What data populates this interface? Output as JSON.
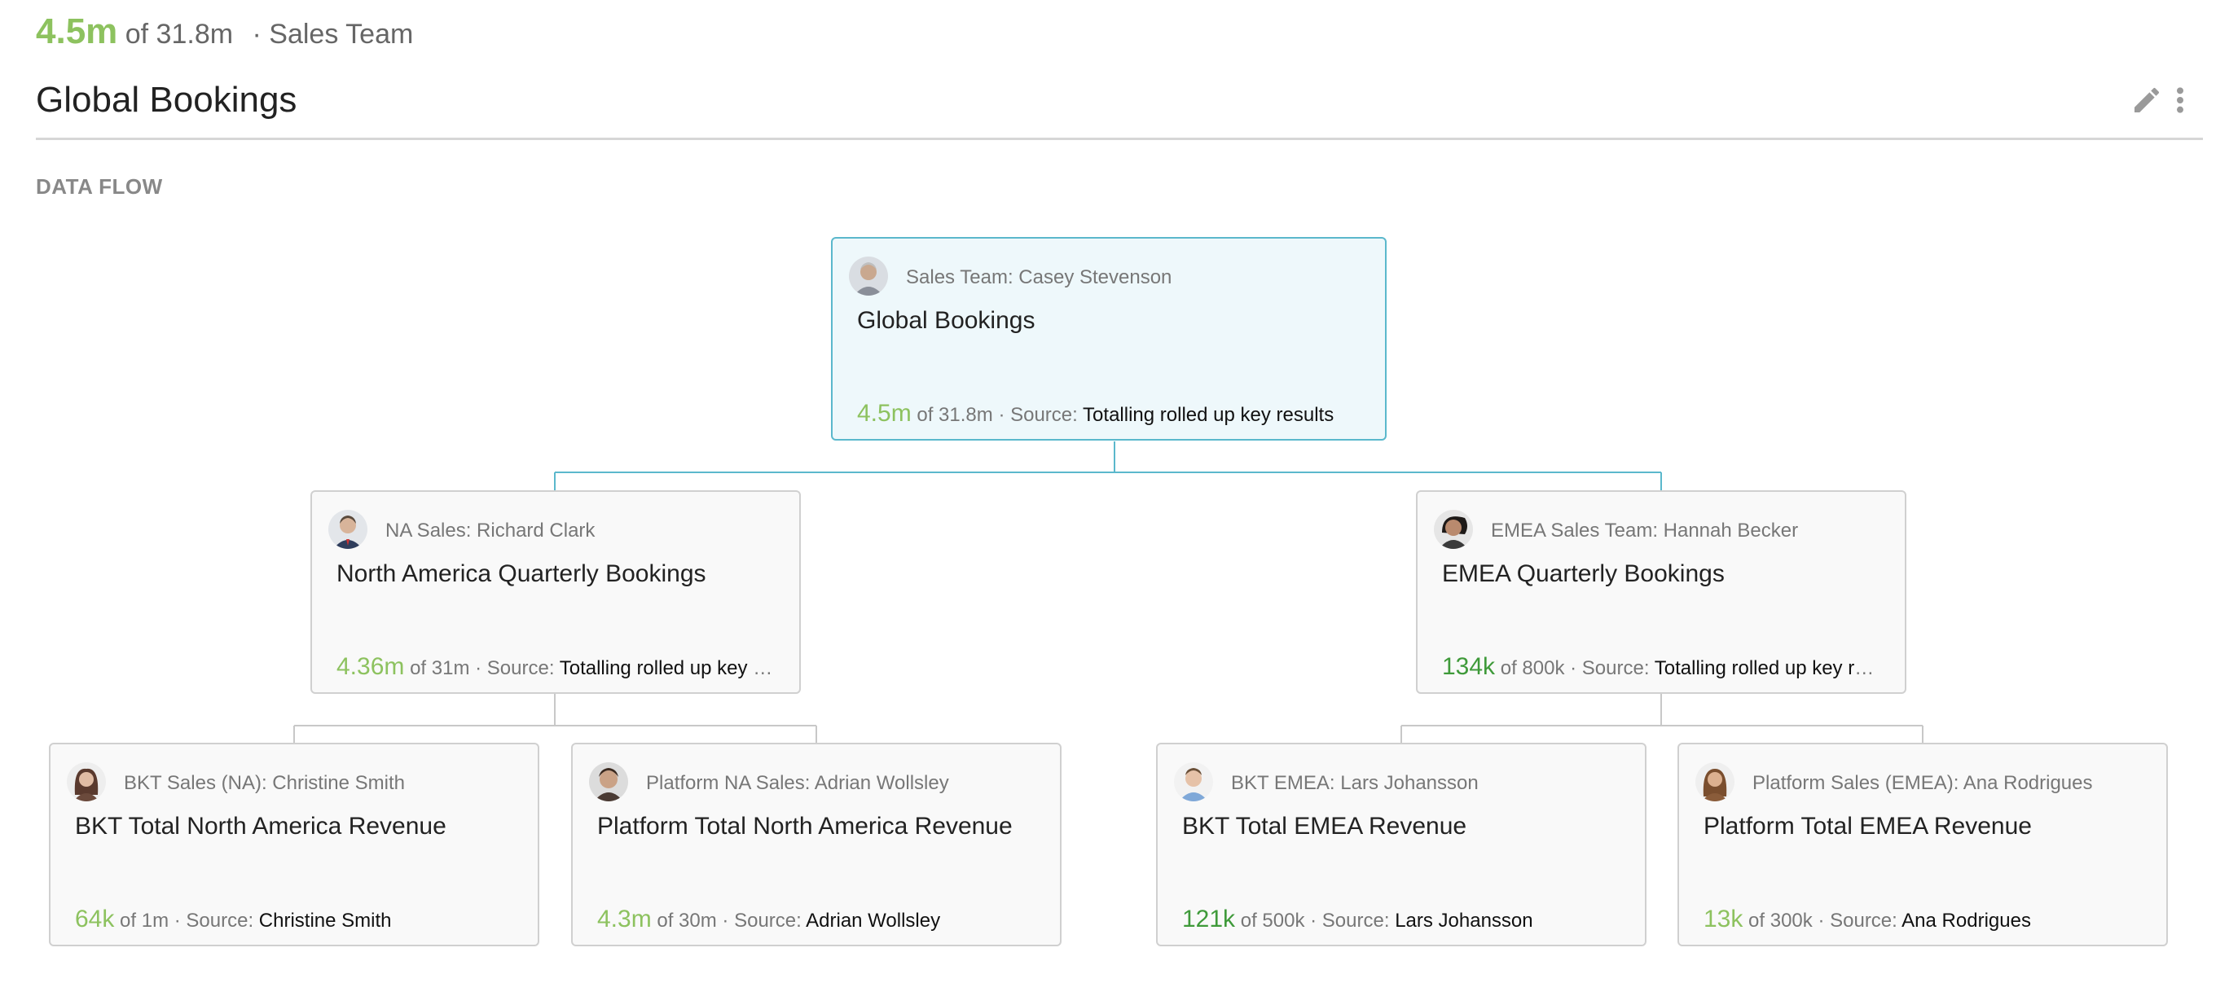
{
  "header": {
    "summary_value": "4.5m",
    "summary_of": "of 31.8m",
    "summary_team": "· Sales Team",
    "title": "Global Bookings",
    "edit_icon": "pencil-icon",
    "more_icon": "more-vertical-icon"
  },
  "section": {
    "label": "DATA FLOW"
  },
  "colors": {
    "accent_green": "#8dc25f",
    "dark_green": "#3f9a3a",
    "root_border": "#5bb8cc",
    "root_bg": "#eef8fb",
    "node_border": "#d0d0d0",
    "connector_root": "#5bb8cc",
    "connector": "#c8c8c8"
  },
  "nodes": {
    "root": {
      "owner": "Sales Team: Casey Stevenson",
      "name": "Global Bookings",
      "value": "4.5m",
      "of": "of 31.8m",
      "source_label": "· Source:",
      "source": "Totalling rolled up key results"
    },
    "na": {
      "owner": "NA Sales: Richard Clark",
      "name": "North America Quarterly Bookings",
      "value": "4.36m",
      "of": "of 31m",
      "source_label": "· Source:",
      "source": "Totalling rolled up key results"
    },
    "emea": {
      "owner": "EMEA Sales Team: Hannah Becker",
      "name": "EMEA Quarterly Bookings",
      "value": "134k",
      "of": "of 800k",
      "source_label": "· Source:",
      "source": "Totalling rolled up key results"
    },
    "bkt_na": {
      "owner": "BKT Sales (NA): Christine Smith",
      "name": "BKT Total North America Revenue",
      "value": "64k",
      "of": "of 1m",
      "source_label": "· Source:",
      "source": "Christine Smith"
    },
    "platform_na": {
      "owner": "Platform NA Sales: Adrian Wollsley",
      "name": "Platform Total North America Revenue",
      "value": "4.3m",
      "of": "of 30m",
      "source_label": "· Source:",
      "source": "Adrian Wollsley"
    },
    "bkt_emea": {
      "owner": "BKT EMEA: Lars Johansson",
      "name": "BKT Total EMEA Revenue",
      "value": "121k",
      "of": "of 500k",
      "source_label": "· Source:",
      "source": "Lars Johansson"
    },
    "platform_emea": {
      "owner": "Platform Sales (EMEA): Ana Rodrigues",
      "name": "Platform Total EMEA Revenue",
      "value": "13k",
      "of": "of 300k",
      "source_label": "· Source:",
      "source": "Ana Rodrigues"
    }
  }
}
